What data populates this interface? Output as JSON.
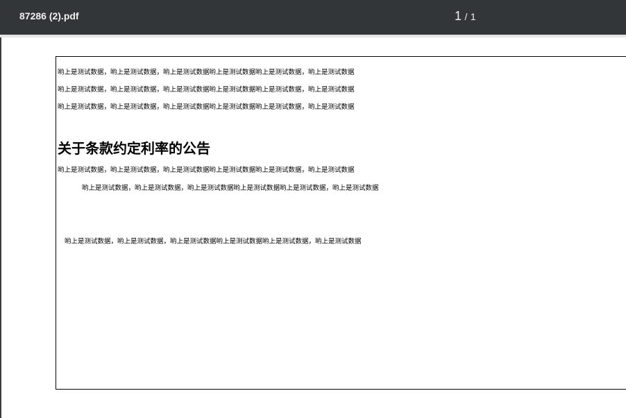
{
  "toolbar": {
    "filename": "87286 (2).pdf",
    "page_current": "1",
    "page_separator": "/",
    "page_total": "1"
  },
  "document": {
    "lines_top": [
      "哟上是测试数据，哟上是测试数据，哟上是测试数据哟上是测试数据哟上是测试数据，哟上是测试数据",
      "哟上是测试数据，哟上是测试数据，哟上是测试数据哟上是测试数据哟上是测试数据，哟上是测试数据",
      "哟上是测试数据，哟上是测试数据，哟上是测试数据哟上是测试数据哟上是测试数据，哟上是测试数据"
    ],
    "heading": "关于条款约定利率的公告",
    "lines_bottom": [
      "哟上是测试数据，哟上是测试数据，哟上是测试数据哟上是测试数据哟上是测试数据，哟上是测试数据",
      "哟上是测试数据，哟上是测试数据，哟上是测试数据哟上是测试数据哟上是测试数据，哟上是测试数据",
      "哟上是测试数据，哟上是测试数据，哟上是测试数据哟上是测试数据哟上是测试数据，哟上是测试数据"
    ]
  },
  "colors": {
    "toolbar_bg": "#323639",
    "toolbar_text": "#f1f1f1",
    "page_bg": "#ffffff",
    "page_border": "#000000"
  }
}
